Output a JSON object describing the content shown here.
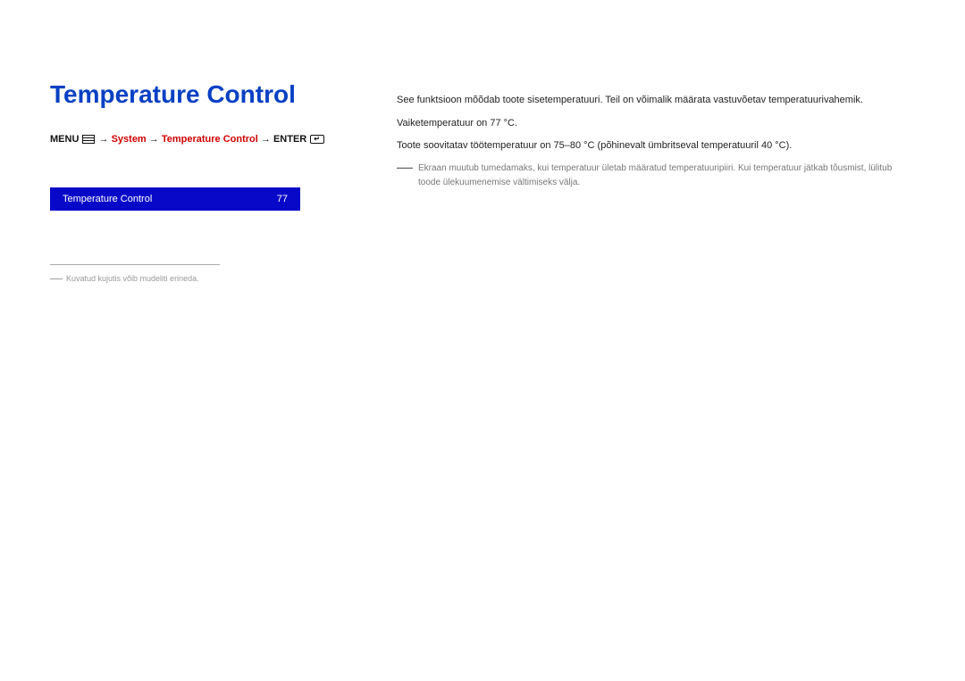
{
  "title": "Temperature Control",
  "nav": {
    "menu": "MENU",
    "arrow": "→",
    "system": "System",
    "temp": "Temperature Control",
    "enter": "ENTER"
  },
  "setting": {
    "label": "Temperature Control",
    "value": "77"
  },
  "footnote": {
    "dash": "―",
    "text": "Kuvatud kujutis võib mudeliti erineda."
  },
  "body": {
    "p1": "See funktsioon mõõdab toote sisetemperatuuri. Teil on võimalik määrata vastuvõetav temperatuurivahemik.",
    "p2": "Vaiketemperatuur on 77 °C.",
    "p3": "Toote soovitatav töötemperatuur on 75–80 °C (põhinevalt ümbritseval temperatuuril 40 °C).",
    "noteDash": "―",
    "note": "Ekraan muutub tumedamaks, kui temperatuur ületab määratud temperatuuripiiri. Kui temperatuur jätkab tõusmist, lülitub toode ülekuumenemise vältimiseks välja."
  }
}
